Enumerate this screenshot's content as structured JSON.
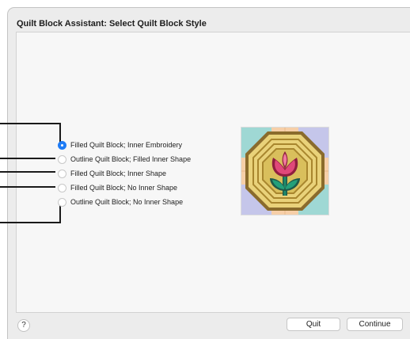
{
  "window": {
    "title": "Quilt Block Assistant: Select Quilt Block Style"
  },
  "style_options": {
    "selected_index": 0,
    "items": [
      {
        "label": "Filled Quilt Block; Inner Embroidery",
        "selected": true
      },
      {
        "label": "Outline Quilt Block; Filled Inner Shape",
        "selected": false
      },
      {
        "label": "Filled Quilt Block; Inner Shape",
        "selected": false
      },
      {
        "label": "Filled Quilt Block; No Inner Shape",
        "selected": false
      },
      {
        "label": "Outline Quilt Block; No Inner Shape",
        "selected": false
      }
    ]
  },
  "preview": {
    "icon": "quilt-block-tulip-preview",
    "colors": {
      "corner_teal": "#9fd8d4",
      "corner_lavender": "#c5c6ea",
      "sash_peach": "#f6cfa8",
      "octagon_border": "#8a6b2c",
      "octagon_fill": "#c9a94a",
      "tulip_pink": "#e0487a",
      "leaf_green": "#1f8a6a"
    }
  },
  "footer": {
    "help_label": "?",
    "quit_label": "Quit",
    "continue_label": "Continue"
  }
}
